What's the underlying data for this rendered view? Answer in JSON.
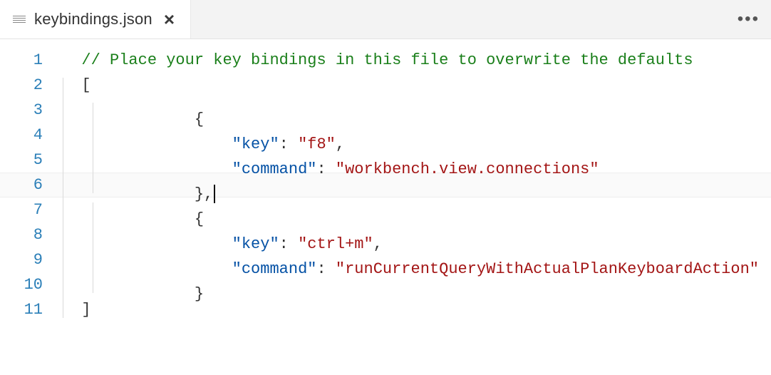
{
  "tab": {
    "filename": "keybindings.json"
  },
  "code": {
    "comment": "// Place your key bindings in this file to overwrite the defaults",
    "open_bracket": "[",
    "obj_open": "{",
    "obj_close": "}",
    "obj_close_comma": "},",
    "close_bracket": "]",
    "key_label": "\"key\"",
    "command_label": "\"command\"",
    "colon_space": ": ",
    "comma": ",",
    "entry1_key": "\"f8\"",
    "entry1_command": "\"workbench.view.connections\"",
    "entry2_key": "\"ctrl+m\"",
    "entry2_command": "\"runCurrentQueryWithActualPlanKeyboardAction\""
  },
  "lineNumbers": [
    "1",
    "2",
    "3",
    "4",
    "5",
    "6",
    "7",
    "8",
    "9",
    "10",
    "11"
  ]
}
